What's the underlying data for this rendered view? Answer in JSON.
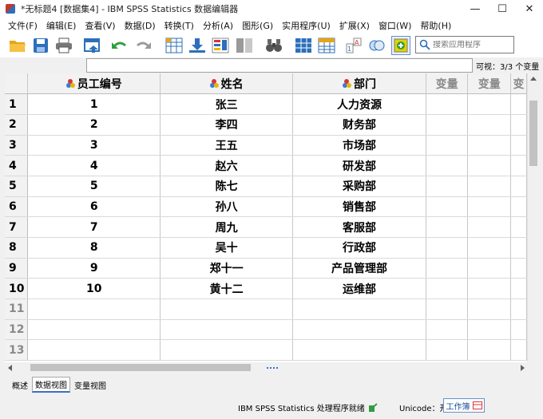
{
  "window": {
    "title": "*无标题4 [数据集4] - IBM SPSS Statistics 数据编辑器",
    "minimize": "—",
    "maximize": "☐",
    "close": "✕"
  },
  "menu": [
    "文件(F)",
    "编辑(E)",
    "查看(V)",
    "数据(D)",
    "转换(T)",
    "分析(A)",
    "图形(G)",
    "实用程序(U)",
    "扩展(X)",
    "窗口(W)",
    "帮助(H)"
  ],
  "toolbar": {
    "search_placeholder": "搜索应用程序"
  },
  "editor": {
    "visible_count": "可视：3/3 个变量"
  },
  "grid": {
    "columns": [
      "员工编号",
      "姓名",
      "部门",
      "变量",
      "变量",
      "变"
    ],
    "row_numbers": [
      "1",
      "2",
      "3",
      "4",
      "5",
      "6",
      "7",
      "8",
      "9",
      "10",
      "11",
      "12",
      "13"
    ],
    "rows": [
      [
        "1",
        "张三",
        "人力资源"
      ],
      [
        "2",
        "李四",
        "财务部"
      ],
      [
        "3",
        "王五",
        "市场部"
      ],
      [
        "4",
        "赵六",
        "研发部"
      ],
      [
        "5",
        "陈七",
        "采购部"
      ],
      [
        "6",
        "孙八",
        "销售部"
      ],
      [
        "7",
        "周九",
        "客服部"
      ],
      [
        "8",
        "吴十",
        "行政部"
      ],
      [
        "9",
        "郑十一",
        "产品管理部"
      ],
      [
        "10",
        "黄十二",
        "运维部"
      ]
    ]
  },
  "view_tabs": [
    "概述",
    "数据视图",
    "变量视图"
  ],
  "active_view_tab": "数据视图",
  "status": {
    "processor": "IBM SPSS Statistics 处理程序就绪",
    "unicode": "Unicode：开",
    "workbook": "工作簿"
  },
  "colors": {
    "accent": "#3c6fc4",
    "folder": "#e8a317",
    "save": "#2c6fbb",
    "undo": "#2e9e3f",
    "plus": "#2e9e3f"
  }
}
